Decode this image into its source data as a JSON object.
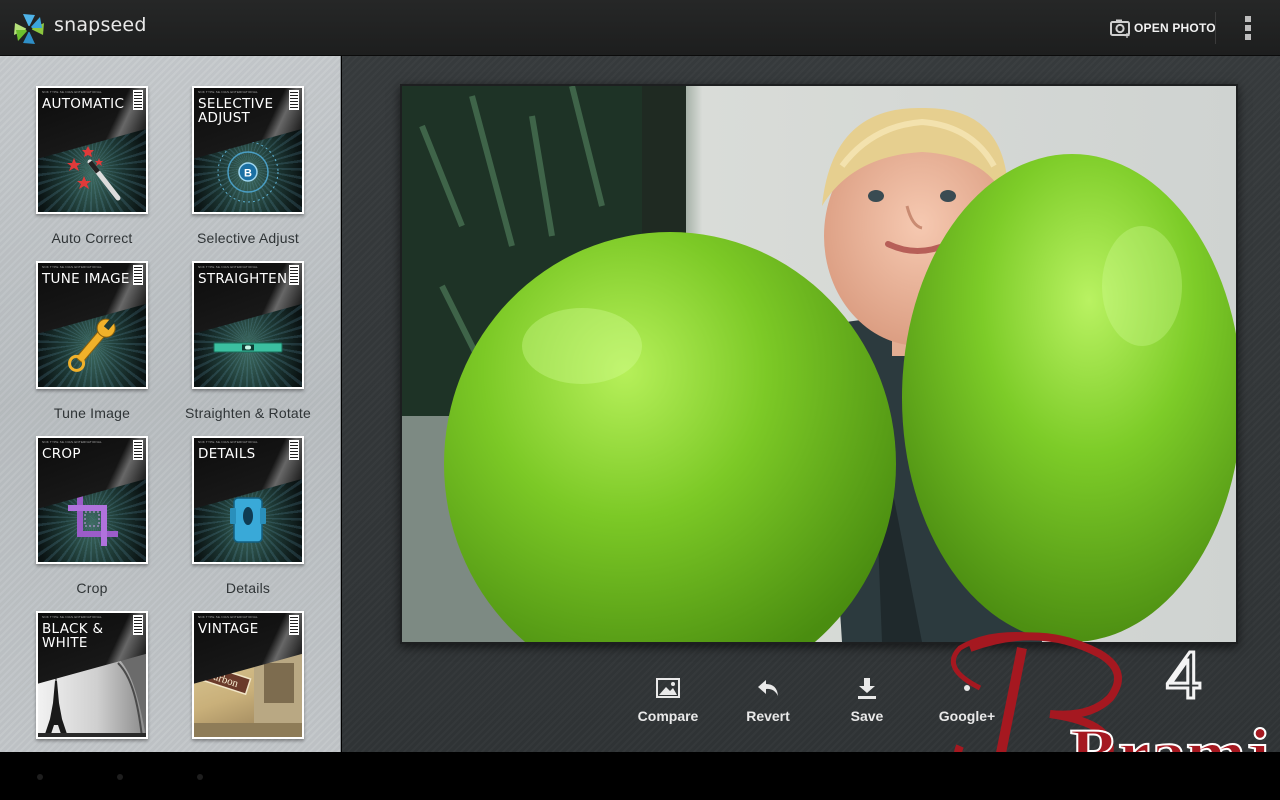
{
  "app": {
    "name": "snapseed",
    "logo_icon": "snapseed-logo-icon"
  },
  "toolbar": {
    "open_photo_label": "OPEN PHOTO",
    "open_photo_icon": "camera-icon",
    "overflow_icon": "overflow-menu-icon"
  },
  "tools": [
    {
      "card_title": "AUTOMATIC",
      "label": "Auto Correct",
      "icon": "magic-wand-icon"
    },
    {
      "card_title": "SELECTIVE\nADJUST",
      "label": "Selective Adjust",
      "icon": "control-point-icon"
    },
    {
      "card_title": "TUNE IMAGE",
      "label": "Tune Image",
      "icon": "wrench-icon"
    },
    {
      "card_title": "STRAIGHTEN",
      "label": "Straighten & Rotate",
      "icon": "spirit-level-icon"
    },
    {
      "card_title": "CROP",
      "label": "Crop",
      "icon": "crop-icon"
    },
    {
      "card_title": "DETAILS",
      "label": "Details",
      "icon": "sharpener-icon"
    },
    {
      "card_title": "BLACK &\nWHITE",
      "label": "",
      "icon": "eiffel-tower-icon"
    },
    {
      "card_title": "VINTAGE",
      "label": "",
      "icon": "vintage-sign-icon"
    }
  ],
  "actions": {
    "compare_label": "Compare",
    "revert_label": "Revert",
    "save_label": "Save",
    "share_label": "Google+"
  },
  "watermark": {
    "text": "Bramj",
    "number": "4"
  },
  "colors": {
    "topbar": "#222323",
    "sidebar": "#bfc3c6",
    "main_bg": "#33373a",
    "balloon_green": "#6ab81e"
  }
}
